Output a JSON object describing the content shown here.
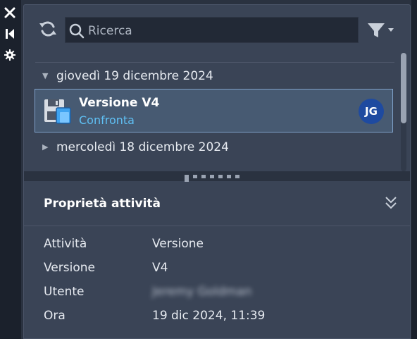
{
  "left_toolbar": {
    "close_icon": "close-icon",
    "dock_icon": "dock-icon",
    "settings_icon": "gear-icon"
  },
  "toolbar": {
    "refresh_icon": "refresh-icon",
    "search_placeholder": "Ricerca",
    "filter_icon": "filter-icon"
  },
  "timeline": {
    "groups": [
      {
        "label": "giovedì 19 dicembre 2024",
        "expanded": true
      },
      {
        "label": "mercoledì 18 dicembre 2024",
        "expanded": false
      }
    ],
    "selected_item": {
      "title": "Versione V4",
      "link": "Confronta",
      "avatar_initials": "JG",
      "avatar_color": "#1e4aa0"
    }
  },
  "properties": {
    "title": "Proprietà attività",
    "rows": [
      {
        "label": "Attività",
        "value": "Versione"
      },
      {
        "label": "Versione",
        "value": "V4"
      },
      {
        "label": "Utente",
        "value": "Jeremy Goldman"
      },
      {
        "label": "Ora",
        "value": "19 dic 2024, 11:39"
      }
    ]
  },
  "colors": {
    "panel_bg": "#3a4456",
    "selection_bg": "#475a72",
    "selection_border": "#7fa1c8",
    "link": "#5fc0f4"
  }
}
